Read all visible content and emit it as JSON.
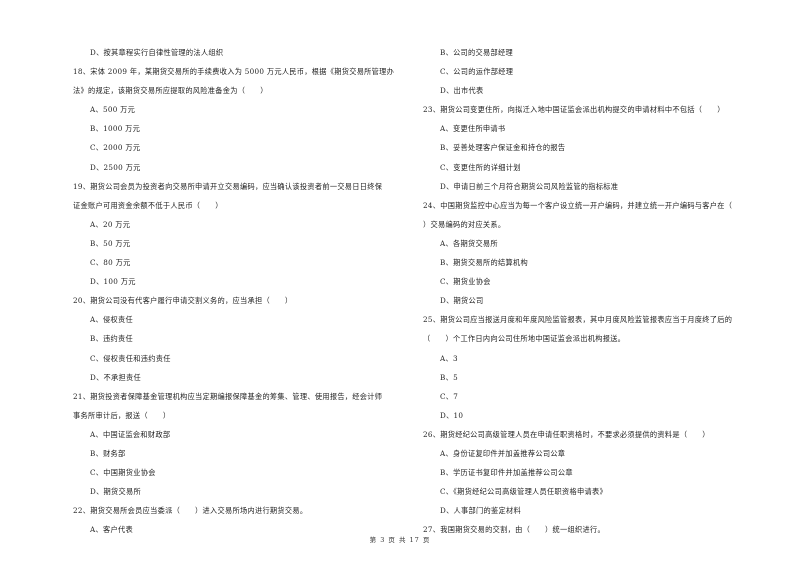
{
  "left_column": [
    {
      "type": "opt",
      "text": "D、按其章程实行自律性管理的法人组织"
    },
    {
      "type": "q",
      "text": "18、宋体 2009 年，某期货交易所的手续费收入为 5000 万元人民币，根据《期货交易所管理办"
    },
    {
      "type": "q",
      "text": "法》的规定，该期货交易所应提取的风险准备金为（　　）"
    },
    {
      "type": "opt",
      "text": "A、500 万元"
    },
    {
      "type": "opt",
      "text": "B、1000 万元"
    },
    {
      "type": "opt",
      "text": "C、2000 万元"
    },
    {
      "type": "opt",
      "text": "D、2500 万元"
    },
    {
      "type": "q",
      "text": "19、期货公司会员为投资者向交易所申请开立交易编码，应当确认该投资者前一交易日日终保"
    },
    {
      "type": "q",
      "text": "证金账户可用资金余额不低于人民币（　　）"
    },
    {
      "type": "opt",
      "text": "A、20 万元"
    },
    {
      "type": "opt",
      "text": "B、50 万元"
    },
    {
      "type": "opt",
      "text": "C、80 万元"
    },
    {
      "type": "opt",
      "text": "D、100 万元"
    },
    {
      "type": "q",
      "text": "20、期货公司没有代客户履行申请交割义务的，应当承担（　　）"
    },
    {
      "type": "opt",
      "text": "A、侵权责任"
    },
    {
      "type": "opt",
      "text": "B、违约责任"
    },
    {
      "type": "opt",
      "text": "C、侵权责任和违约责任"
    },
    {
      "type": "opt",
      "text": "D、不承担责任"
    },
    {
      "type": "q",
      "text": "21、期货投资者保障基金管理机构应当定期编报保障基金的筹集、管理、使用报告，经会计师"
    },
    {
      "type": "q",
      "text": "事务所审计后，报送（　　）"
    },
    {
      "type": "opt",
      "text": "A、中国证监会和财政部"
    },
    {
      "type": "opt",
      "text": "B、财务部"
    },
    {
      "type": "opt",
      "text": "C、中国期货业协会"
    },
    {
      "type": "opt",
      "text": "D、期货交易所"
    },
    {
      "type": "q",
      "text": "22、期货交易所会员应当委派（　　）进入交易所场内进行期货交易。"
    },
    {
      "type": "opt",
      "text": "A、客户代表"
    }
  ],
  "right_column": [
    {
      "type": "opt",
      "text": "B、公司的交易部经理"
    },
    {
      "type": "opt",
      "text": "C、公司的运作部经理"
    },
    {
      "type": "opt",
      "text": "D、出市代表"
    },
    {
      "type": "q",
      "text": "23、期货公司变更住所，向拟迁入地中国证监会派出机构提交的申请材料中不包括（　　）"
    },
    {
      "type": "opt",
      "text": "A、变更住所申请书"
    },
    {
      "type": "opt",
      "text": "B、妥善处理客户保证金和持仓的报告"
    },
    {
      "type": "opt",
      "text": "C、变更住所的详细计划"
    },
    {
      "type": "opt",
      "text": "D、申请日前三个月符合期货公司风险监管的指标标准"
    },
    {
      "type": "q",
      "text": "24、中国期货监控中心应当为每一个客户设立统一开户编码，并建立统一开户编码与客户在（"
    },
    {
      "type": "q",
      "text": "）交易编码的对应关系。"
    },
    {
      "type": "opt",
      "text": "A、各期货交易所"
    },
    {
      "type": "opt",
      "text": "B、期货交易所的结算机构"
    },
    {
      "type": "opt",
      "text": "C、期货业协会"
    },
    {
      "type": "opt",
      "text": "D、期货公司"
    },
    {
      "type": "q",
      "text": "25、期货公司应当报送月度和年度风险监管报表，其中月度风险监管报表应当于月度终了后的"
    },
    {
      "type": "q",
      "text": "（　　）个工作日内向公司住所地中国证监会派出机构报送。"
    },
    {
      "type": "opt",
      "text": "A、3"
    },
    {
      "type": "opt",
      "text": "B、5"
    },
    {
      "type": "opt",
      "text": "C、7"
    },
    {
      "type": "opt",
      "text": "D、10"
    },
    {
      "type": "q",
      "text": "26、期货经纪公司高级管理人员在申请任职资格时，不要求必须提供的资料是（　　）"
    },
    {
      "type": "opt",
      "text": "A、身份证复印件并加盖推荐公司公章"
    },
    {
      "type": "opt",
      "text": "B、学历证书复印件并加盖推荐公司公章"
    },
    {
      "type": "opt",
      "text": "C、《期货经纪公司高级管理人员任职资格申请表》"
    },
    {
      "type": "opt",
      "text": "D、人事部门的鉴定材料"
    },
    {
      "type": "q",
      "text": "27、我国期货交易的交割，由（　　）统一组织进行。"
    }
  ],
  "footer": {
    "page_label": "第 3 页 共 17 页"
  }
}
